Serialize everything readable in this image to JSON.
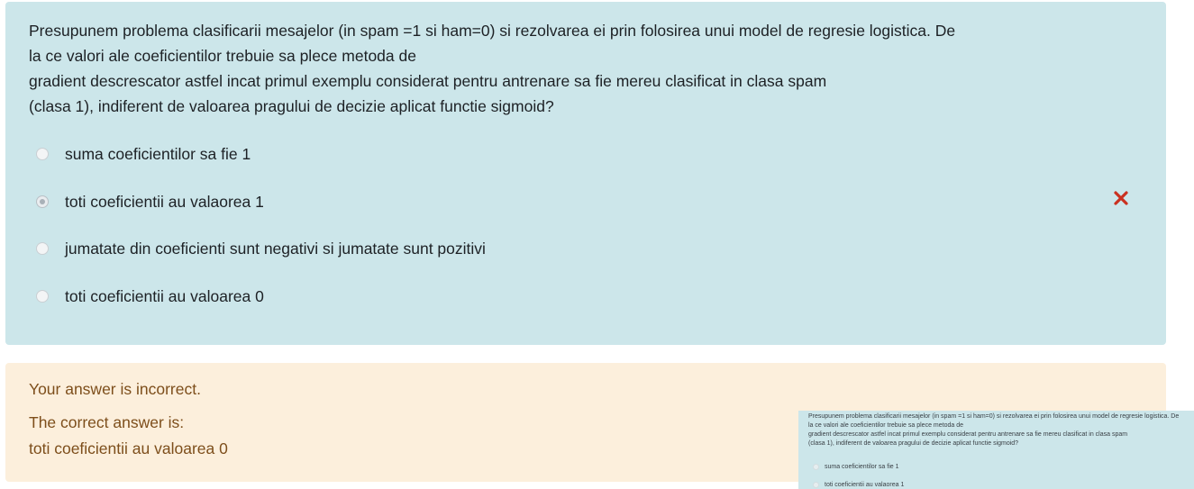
{
  "question": {
    "lines": [
      "Presupunem problema clasificarii mesajelor (in spam =1 si ham=0) si rezolvarea ei prin folosirea unui model de regresie logistica. De",
      "la ce valori ale coeficientilor trebuie sa plece metoda de",
      "gradient descrescator astfel incat primul exemplu considerat pentru antrenare sa fie mereu clasificat in clasa spam",
      "(clasa 1), indiferent de valoarea pragului de decizie aplicat functie sigmoid?"
    ],
    "options": [
      {
        "label": "suma coeficientilor sa fie 1",
        "selected": false
      },
      {
        "label": "toti coeficientii au valaorea 1",
        "selected": true,
        "incorrect_mark": true
      },
      {
        "label": "jumatate din coeficienti sunt negativi si jumatate sunt pozitivi",
        "selected": false
      },
      {
        "label": "toti coeficientii au valoarea 0",
        "selected": false
      }
    ]
  },
  "icons": {
    "incorrect": "close-icon",
    "incorrect_color": "#ca3120"
  },
  "feedback": {
    "status": "Your answer is incorrect.",
    "correct_label": "The correct answer is:",
    "correct_answer": "toti coeficientii au valoarea 0"
  },
  "thumbnail": {
    "lines": [
      "Presupunem problema clasificarii mesajelor (in spam =1 si ham=0) si rezolvarea ei prin folosirea unui model de regresie logistica. De",
      "la ce valori ale coeficientilor trebuie sa plece metoda de",
      "gradient descrescator astfel incat primul exemplu considerat pentru antrenare sa fie mereu clasificat in clasa spam",
      "(clasa 1), indiferent de valoarea pragului de decizie aplicat functie sigmoid?"
    ],
    "options": [
      "suma coeficientilor sa fie 1",
      "toti coeficientii au valaorea 1"
    ]
  },
  "colors": {
    "question_bg": "#cce6ea",
    "feedback_bg": "#fcefdc",
    "feedback_text": "#7d4e1b"
  }
}
